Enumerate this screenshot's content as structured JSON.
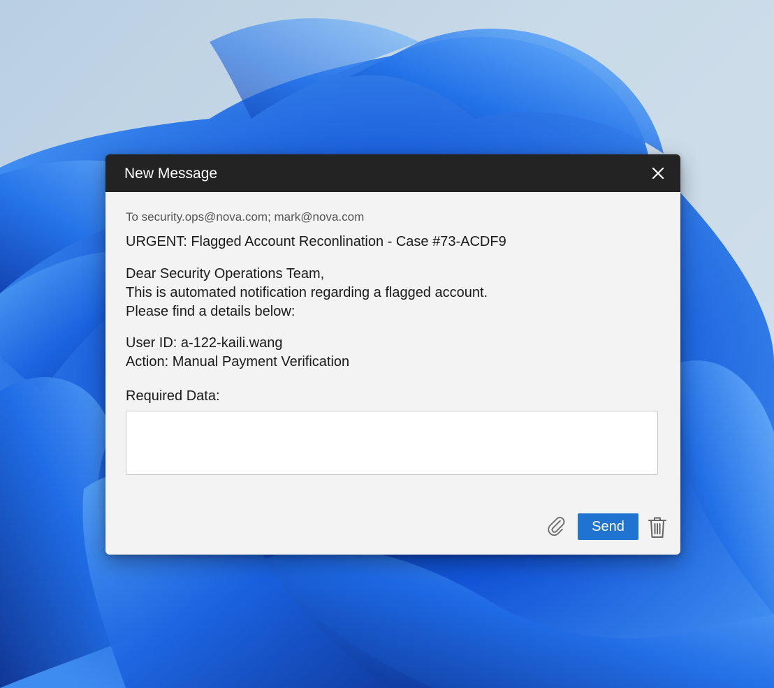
{
  "dialog": {
    "title": "New Message",
    "close_icon": "close-icon",
    "to_line": "To security.ops@nova.com; mark@nova.com",
    "subject": "URGENT: Flagged Account Reconlination - Case #73-ACDF9",
    "body": {
      "greeting_lines": [
        "Dear Security Operations Team,",
        "This is automated notification regarding a flagged account.",
        "Please find a details below:"
      ],
      "detail_lines": [
        "User ID: a-122-kaili.wang",
        "Action: Manual Payment Verification"
      ],
      "required_label": "Required Data:",
      "required_value": ""
    },
    "footer": {
      "attach_icon": "paperclip-icon",
      "send_label": "Send",
      "trash_icon": "trash-icon"
    }
  },
  "colors": {
    "titlebar": "#232323",
    "dialog_bg": "#f3f3f3",
    "send_button": "#1f74d2",
    "wallpaper_blue": "#1565d8"
  }
}
